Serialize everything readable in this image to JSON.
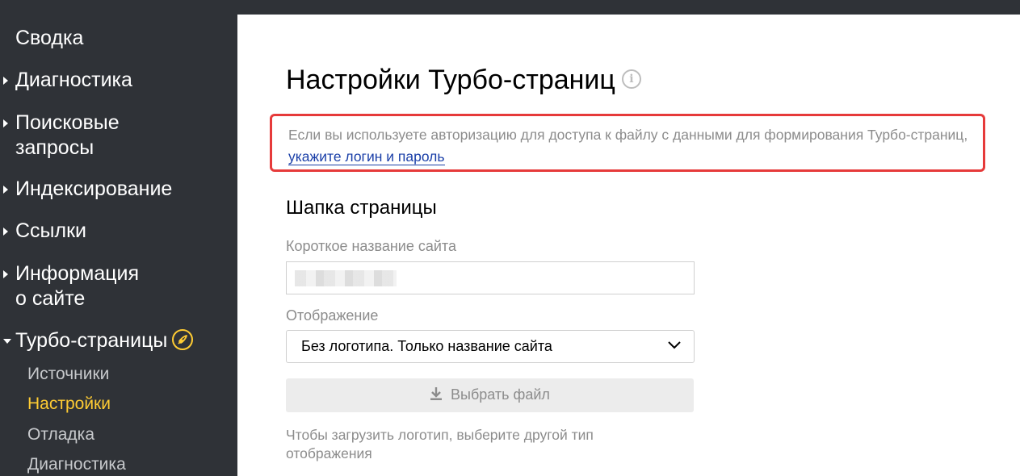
{
  "sidebar": {
    "items": [
      {
        "label": "Сводка"
      },
      {
        "label": "Диагностика"
      },
      {
        "label_line1": "Поисковые",
        "label_line2": "запросы"
      },
      {
        "label": "Индексирование"
      },
      {
        "label": "Ссылки"
      },
      {
        "label_line1": "Информация",
        "label_line2": "о сайте"
      },
      {
        "label": "Турбо-страницы",
        "icon": "rocket-icon"
      }
    ],
    "subitems": [
      {
        "label": "Источники"
      },
      {
        "label": "Настройки",
        "active": true
      },
      {
        "label": "Отладка"
      },
      {
        "label": "Диагностика"
      }
    ]
  },
  "main": {
    "title": "Настройки Турбо-страниц",
    "info_icon_glyph": "i",
    "notice": {
      "text": "Если вы используете авторизацию для доступа к файлу с данными для формирования Турбо-страниц, ",
      "link": "укажите логин и пароль"
    },
    "section_title": "Шапка страницы",
    "short_name_label": "Короткое название сайта",
    "display_label": "Отображение",
    "display_value": "Без логотипа. Только название сайта",
    "file_button": "Выбрать файл",
    "hint": "Чтобы загрузить логотип, выберите другой тип отображения"
  },
  "colors": {
    "sidebar_bg": "#2f3237",
    "active_subitem": "#ffcc33",
    "notice_border": "#e63a3a",
    "link": "#1a3fa8"
  }
}
